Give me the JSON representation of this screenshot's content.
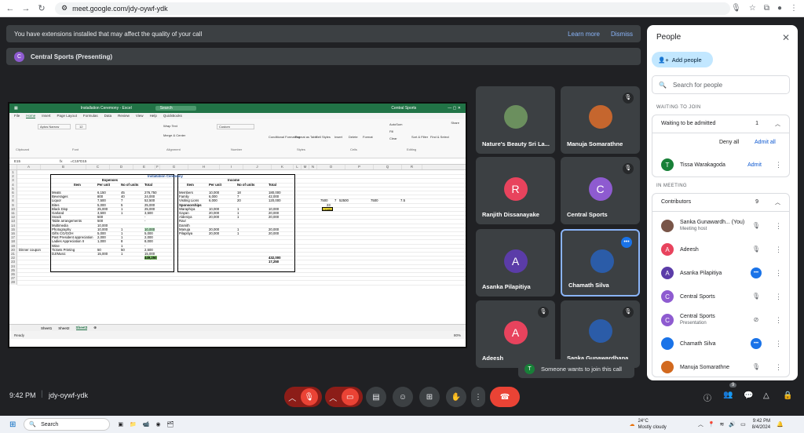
{
  "browser": {
    "url": "meet.google.com/jdy-oywf-ydk"
  },
  "notice": {
    "text": "You have extensions installed that may affect the quality of your call",
    "learn_more": "Learn more",
    "dismiss": "Dismiss"
  },
  "presenting": {
    "initial": "C",
    "label": "Central Sports (Presenting)"
  },
  "excel": {
    "title": "Installation Ceremony - Excel",
    "search": "Search",
    "account": "Central Sports",
    "menu": [
      "File",
      "Home",
      "Insert",
      "Page Layout",
      "Formulas",
      "Data",
      "Review",
      "View",
      "Help",
      "QuickBooks"
    ],
    "share": "Share",
    "font": "Aptos Narrow",
    "font_size": "12",
    "number_format": "Custom",
    "ribbon_labels": [
      "Clipboard",
      "Font",
      "Alignment",
      "Number",
      "Styles",
      "Cells",
      "Editing"
    ],
    "ribbon_buttons": [
      "Wrap Text",
      "Merge & Center",
      "Conditional Formatting",
      "Format as Table",
      "Cell Styles",
      "Insert",
      "Delete",
      "Format",
      "AutoSum",
      "Fill",
      "Clear",
      "Sort & Filter",
      "Find & Select"
    ],
    "cell_ref": "E15",
    "formula": "=C15*D15",
    "columns": [
      "A",
      "B",
      "C",
      "D",
      "E",
      "F",
      "G",
      "H",
      "I",
      "J",
      "K",
      "L",
      "M",
      "N",
      "O",
      "P",
      "Q",
      "R"
    ],
    "heading": "Installation Ceremony",
    "expenses_header": "Expenses",
    "income_header": "Income",
    "exp_cols": [
      "Item",
      "Per unit",
      "No of units",
      "Total"
    ],
    "inc_cols": [
      "Item",
      "Per unit",
      "No of units",
      "Total"
    ],
    "expenses": [
      [
        "Meats",
        "6,150",
        "45",
        "276,750"
      ],
      [
        "Beverages",
        "800",
        "40",
        "24,000"
      ],
      [
        "Liquor",
        "7,500",
        "7",
        "52,500"
      ],
      [
        "Bites",
        "5,000",
        "5",
        "25,000"
      ],
      [
        "Black Disp",
        "25,000",
        "1",
        "25,000"
      ],
      [
        "Garland",
        "3,500",
        "1",
        "3,500"
      ],
      [
        "Snack",
        "500",
        "",
        "-"
      ],
      [
        "Table arrangements",
        "500",
        "",
        "-"
      ],
      [
        "Multimedia",
        "10,000",
        "",
        ""
      ],
      [
        "Photography",
        "10,000",
        "1",
        "10,000"
      ],
      [
        "Gifts CG/GOH",
        "5,000",
        "1",
        "5,000"
      ],
      [
        "Past President appreciation",
        "2,000",
        "1",
        "2,000"
      ],
      [
        "Ladies Appreciation II",
        "1,000",
        "8",
        "8,000"
      ],
      [
        "Wine",
        "",
        "1",
        "-"
      ],
      [
        "Tickets Printing",
        "50",
        "50",
        "2,500"
      ],
      [
        "DJ/Music",
        "15,000",
        "1",
        "15,000"
      ]
    ],
    "exp_total": "449,250",
    "income": [
      [
        "Members",
        "10,000",
        "18",
        "180,000"
      ],
      [
        "Family",
        "6,000",
        "7",
        "42,000"
      ],
      [
        "Visiting Lions",
        "6,000",
        "20",
        "120,000"
      ],
      [
        "Sponsorships",
        "",
        "",
        ""
      ],
      [
        "Waraphiya",
        "10,000",
        "1",
        "10,000"
      ],
      [
        "Gayan",
        "20,000",
        "1",
        "20,000"
      ],
      [
        "Aldeniya",
        "20,000",
        "1",
        "20,000"
      ],
      [
        "Ravi",
        "",
        "",
        ""
      ],
      [
        "Damith",
        "",
        "",
        ""
      ],
      [
        "Manuja",
        "20,000",
        "1",
        "20,000"
      ],
      [
        "Pilapitiya",
        "20,000",
        "1",
        "20,000"
      ]
    ],
    "inc_total": "432,000",
    "diff": "17,250",
    "dinner_label": "Dinner coupon",
    "side_vals": [
      "7500",
      "7",
      "52500",
      "7500",
      "7.5",
      "23",
      "11500"
    ],
    "sheets": [
      "Sheet1",
      "Sheet2",
      "Sheet3"
    ],
    "status": "Ready",
    "zoom": "80%"
  },
  "tiles": [
    {
      "name": "Nature's Beauty Sri La...",
      "kind": "photo"
    },
    {
      "name": "Manuja Somarathne",
      "kind": "photo"
    },
    {
      "name": "Ranjith Dissanayake",
      "initial": "R",
      "color": "#e8435d"
    },
    {
      "name": "Central Sports",
      "initial": "C",
      "color": "#8e5bd0"
    },
    {
      "name": "Asanka Pilapitiya",
      "initial": "A",
      "color": "#5b3ca8"
    },
    {
      "name": "Chamath Silva",
      "kind": "photo"
    },
    {
      "name": "Adeesh",
      "initial": "A",
      "color": "#e8435d"
    },
    {
      "name": "Sanka Gunawardhana",
      "kind": "photo"
    }
  ],
  "toast": {
    "initial": "T",
    "text": "Someone wants to join this call"
  },
  "meeting": {
    "time": "9:42 PM",
    "code": "jdy-oywf-ydk",
    "people_count": "9"
  },
  "people": {
    "title": "People",
    "add": "Add people",
    "search_placeholder": "Search for people",
    "waiting_section": "WAITING TO JOIN",
    "waiting_label": "Waiting to be admitted",
    "waiting_count": "1",
    "deny_all": "Deny all",
    "admit_all": "Admit all",
    "waiting_person": "Tissa Warakagoda",
    "admit": "Admit",
    "in_meeting": "IN MEETING",
    "contributors": "Contributors",
    "contributors_count": "9",
    "list": [
      {
        "name": "Sanka Gunawardh... (You)",
        "sub": "Meeting host",
        "initial": "",
        "color": "#795548",
        "icon": "mic-off"
      },
      {
        "name": "Adeesh",
        "sub": "",
        "initial": "A",
        "color": "#e8435d",
        "icon": "mic-off"
      },
      {
        "name": "Asanka Pilapitiya",
        "sub": "",
        "initial": "A",
        "color": "#5b3ca8",
        "icon": "dots-blue"
      },
      {
        "name": "Central Sports",
        "sub": "",
        "initial": "C",
        "color": "#8e5bd0",
        "icon": "mic-off"
      },
      {
        "name": "Central Sports",
        "sub": "Presentation",
        "initial": "C",
        "color": "#8e5bd0",
        "icon": "present-off"
      },
      {
        "name": "Chamath Silva",
        "sub": "",
        "initial": "",
        "color": "#1a73e8",
        "icon": "dots-blue"
      },
      {
        "name": "Manuja Somarathne",
        "sub": "",
        "initial": "",
        "color": "#d2691e",
        "icon": "mic-off"
      }
    ]
  },
  "taskbar": {
    "search": "Search",
    "weather": "24°C",
    "weather_sub": "Mostly cloudy",
    "time": "9:42 PM",
    "date": "8/4/2024"
  }
}
